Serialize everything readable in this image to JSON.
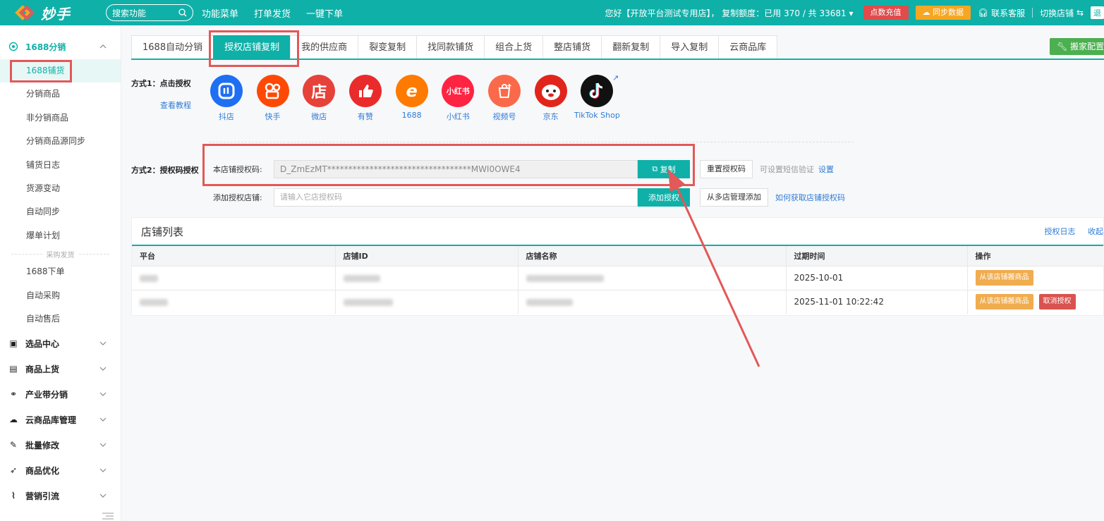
{
  "topbar": {
    "logo_text": "妙手",
    "search_placeholder": "搜索功能",
    "nav": [
      "功能菜单",
      "打单发货",
      "一键下单"
    ],
    "greeting": "您好【开放平台测试专用店】，  复制额度：已用 370 / 共 33681",
    "recharge": "点数充值",
    "sync": "同步数据",
    "support": "联系客服",
    "switch_store": "切换店铺",
    "logout": "退"
  },
  "sidebar": {
    "group_1688": "1688分销",
    "items_1688": [
      "1688铺货",
      "分销商品",
      "非分销商品",
      "分销商品源同步",
      "铺货日志",
      "货源变动",
      "自动同步",
      "爆单计划"
    ],
    "divider": "采购发货",
    "items_purchase": [
      "1688下单",
      "自动采购",
      "自动售后"
    ],
    "groups": [
      "选品中心",
      "商品上货",
      "产业带分销",
      "云商品库管理",
      "批量修改",
      "商品优化",
      "营销引流"
    ]
  },
  "tabs": [
    "1688自动分销",
    "授权店铺复制",
    "我的供应商",
    "裂变复制",
    "找同款铺货",
    "组合上货",
    "整店铺货",
    "翻新复制",
    "导入复制",
    "云商品库"
  ],
  "tab_config": "搬家配置",
  "method1": {
    "label": "方式1：点击授权",
    "tutorial": "查看教程"
  },
  "platforms": [
    {
      "name": "抖店",
      "glyph": "dy",
      "color": "#1f6ff2"
    },
    {
      "name": "快手",
      "glyph": "ks",
      "color": "#fe4906"
    },
    {
      "name": "微店",
      "glyph": "店",
      "color": "#e6423a"
    },
    {
      "name": "有赞",
      "glyph": "👍",
      "color": "#ea2b2b"
    },
    {
      "name": "1688",
      "glyph": "e",
      "color": "#ff7a00"
    },
    {
      "name": "小红书",
      "glyph": "小红书",
      "color": "#ff2442"
    },
    {
      "name": "视频号",
      "glyph": "✚",
      "color": "#fa6a4a"
    },
    {
      "name": "京东",
      "glyph": "jd",
      "color": "#e1251b"
    },
    {
      "name": "TikTok Shop",
      "glyph": "♪",
      "color": "#111111"
    }
  ],
  "method2": {
    "label": "方式2：授权码授权",
    "code_label": "本店铺授权码:",
    "code_value": "D_ZmEzMT**********************************MWI0OWE4",
    "copy_btn": "复制",
    "reset_btn": "重置授权码",
    "sms_hint": "可设置短信验证",
    "sms_link": "设置",
    "add_label": "添加授权店铺:",
    "add_placeholder": "请输入它店授权码",
    "add_btn": "添加授权",
    "multi_btn": "从多店管理添加",
    "how_link": "如何获取店铺授权码"
  },
  "store_list": {
    "title": "店铺列表",
    "log_link": "授权日志",
    "collapse_link": "收起",
    "columns": [
      "平台",
      "店铺ID",
      "店铺名称",
      "过期时间",
      "操作"
    ],
    "rows": [
      {
        "expire": "2025-10-01",
        "actions": [
          "从该店铺搬商品"
        ]
      },
      {
        "expire": "2025-11-01 10:22:42",
        "actions": [
          "从该店铺搬商品",
          "取消授权"
        ]
      }
    ]
  }
}
